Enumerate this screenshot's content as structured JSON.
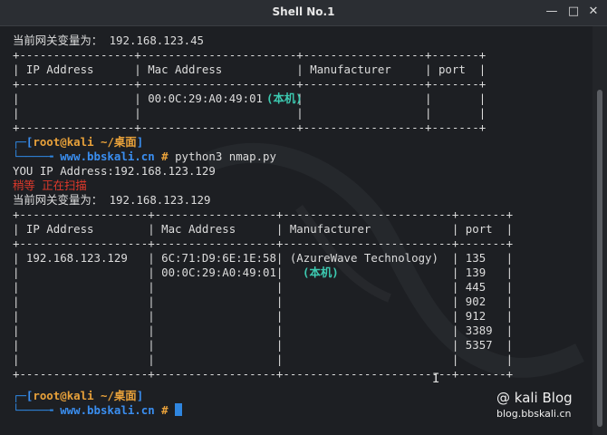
{
  "window": {
    "title": "Shell No.1",
    "minimize_icon": "minimize-icon",
    "maximize_icon": "maximize-icon",
    "close_icon": "close-icon"
  },
  "terminal": {
    "lines": [
      "当前网关变量为： 192.168.123.45",
      "+-----------------+-----------------------+------------------+-------+",
      "| IP Address      | Mac Address           | Manufacturer     | port  |",
      "+-----------------+-----------------------+------------------+-------+",
      "|                 | 00:0C:29:A0:49:01     |                  |       |",
      "|                 |                       |                  |       |",
      "+-----------------+-----------------------+------------------+-------+",
      "",
      "",
      "YOU IP Address:192.168.123.129",
      "",
      "当前网关变量为： 192.168.123.129",
      "+-------------------+------------------+-------------------------+-------+",
      "| IP Address        | Mac Address      | Manufacturer            | port  |",
      "+-------------------+------------------+-------------------------+-------+",
      "| 192.168.123.129   | 6C:71:D9:6E:1E:58| (AzureWave Technology)  | 135   |",
      "|                   | 00:0C:29:A0:49:01|                         | 139   |",
      "|                   |                  |                         | 445   |",
      "|                   |                  |                         | 902   |",
      "|                   |                  |                         | 912   |",
      "|                   |                  |                         | 3389  |",
      "|                   |                  |                         | 5357  |",
      "|                   |                  |                         |       |",
      "+-------------------+------------------+-------------------------+-------+"
    ],
    "local_label": "(本机)",
    "prompt_user": "root@kali",
    "prompt_dir": "~/桌面",
    "prompt_host": "www.bbskali.cn",
    "prompt_symbol": "#",
    "command1": "python3 nmap.py",
    "scanning_text": "稍等 正在扫描"
  },
  "watermark": {
    "title": "@ kali Blog",
    "url": "blog.bbskali.cn"
  }
}
